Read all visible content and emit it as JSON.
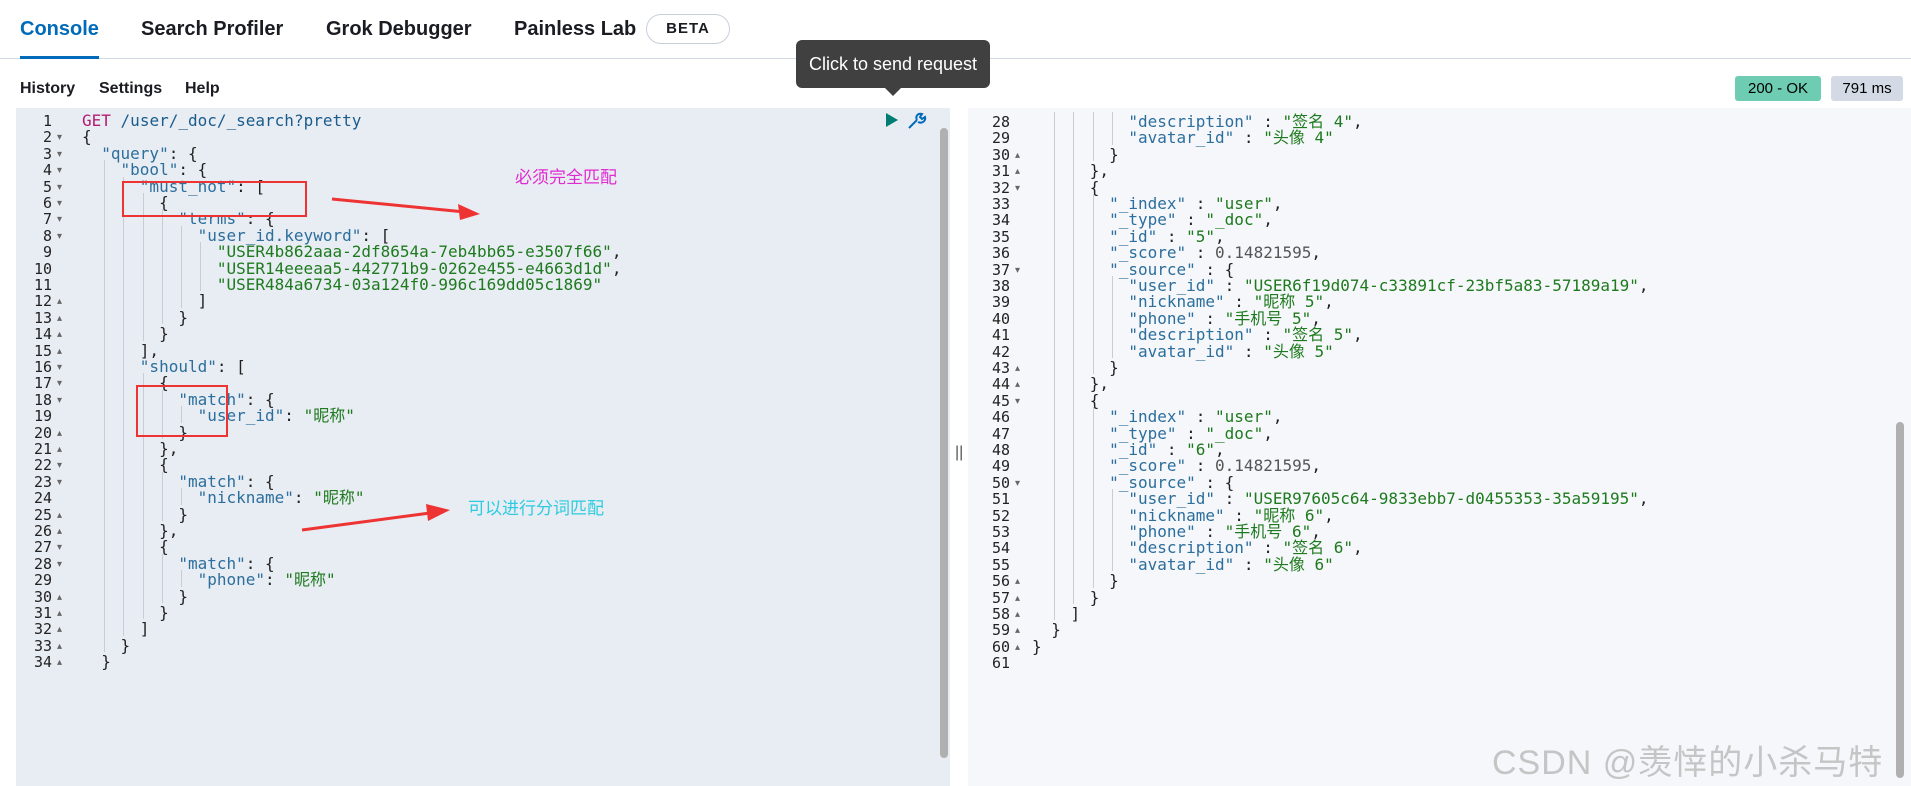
{
  "tabs": [
    {
      "label": "Console",
      "active": true
    },
    {
      "label": "Search Profiler",
      "active": false
    },
    {
      "label": "Grok Debugger",
      "active": false
    },
    {
      "label": "Painless Lab",
      "active": false
    }
  ],
  "beta_badge": "BETA",
  "menu": {
    "history": "History",
    "settings": "Settings",
    "help": "Help"
  },
  "tooltip": "Click to send request",
  "status": {
    "code": "200 - OK",
    "time": "791 ms"
  },
  "annotations": {
    "must_not_note": "必须完全匹配",
    "should_note": "可以进行分词匹配"
  },
  "watermark": "CSDN @羡悻的小杀马特",
  "splitter": "||",
  "colors": {
    "accent": "#006bb8",
    "ok": "#6dccb1",
    "annotation_red": "#ee3333",
    "note_magenta": "#e02bd0",
    "note_cyan": "#2ccbe0"
  },
  "request_lines": [
    {
      "n": 1,
      "t": "GET /user/_doc/_search?pretty",
      "fold": false,
      "type": "req"
    },
    {
      "n": 2,
      "t": "{",
      "fold": true
    },
    {
      "n": 3,
      "t": "  \"query\": {",
      "fold": true
    },
    {
      "n": 4,
      "t": "    \"bool\": {",
      "fold": true
    },
    {
      "n": 5,
      "t": "      \"must_not\": [",
      "fold": true
    },
    {
      "n": 6,
      "t": "        {",
      "fold": true
    },
    {
      "n": 7,
      "t": "          \"terms\": {",
      "fold": true
    },
    {
      "n": 8,
      "t": "            \"user_id.keyword\": [",
      "fold": true
    },
    {
      "n": 9,
      "t": "              \"USER4b862aaa-2df8654a-7eb4bb65-e3507f66\",",
      "fold": false
    },
    {
      "n": 10,
      "t": "              \"USER14eeeaa5-442771b9-0262e455-e4663d1d\",",
      "fold": false
    },
    {
      "n": 11,
      "t": "              \"USER484a6734-03a124f0-996c169dd05c1869\"",
      "fold": false
    },
    {
      "n": 12,
      "t": "            ]",
      "fold": true
    },
    {
      "n": 13,
      "t": "          }",
      "fold": true
    },
    {
      "n": 14,
      "t": "        }",
      "fold": true
    },
    {
      "n": 15,
      "t": "      ],",
      "fold": true
    },
    {
      "n": 16,
      "t": "      \"should\": [",
      "fold": true
    },
    {
      "n": 17,
      "t": "        {",
      "fold": true
    },
    {
      "n": 18,
      "t": "          \"match\": {",
      "fold": true
    },
    {
      "n": 19,
      "t": "            \"user_id\": \"昵称\"",
      "fold": false
    },
    {
      "n": 20,
      "t": "          }",
      "fold": true
    },
    {
      "n": 21,
      "t": "        },",
      "fold": true
    },
    {
      "n": 22,
      "t": "        {",
      "fold": true
    },
    {
      "n": 23,
      "t": "          \"match\": {",
      "fold": true
    },
    {
      "n": 24,
      "t": "            \"nickname\": \"昵称\"",
      "fold": false
    },
    {
      "n": 25,
      "t": "          }",
      "fold": true
    },
    {
      "n": 26,
      "t": "        },",
      "fold": true
    },
    {
      "n": 27,
      "t": "        {",
      "fold": true
    },
    {
      "n": 28,
      "t": "          \"match\": {",
      "fold": true
    },
    {
      "n": 29,
      "t": "            \"phone\": \"昵称\"",
      "fold": false
    },
    {
      "n": 30,
      "t": "          }",
      "fold": true
    },
    {
      "n": 31,
      "t": "        }",
      "fold": true
    },
    {
      "n": 32,
      "t": "      ]",
      "fold": true
    },
    {
      "n": 33,
      "t": "    }",
      "fold": true
    },
    {
      "n": 34,
      "t": "  }",
      "fold": true
    }
  ],
  "response_lines": [
    {
      "n": 28,
      "t": "          \"description\" : \"签名 4\",",
      "fold": false
    },
    {
      "n": 29,
      "t": "          \"avatar_id\" : \"头像 4\"",
      "fold": false
    },
    {
      "n": 30,
      "t": "        }",
      "fold": true
    },
    {
      "n": 31,
      "t": "      },",
      "fold": true
    },
    {
      "n": 32,
      "t": "      {",
      "fold": true
    },
    {
      "n": 33,
      "t": "        \"_index\" : \"user\",",
      "fold": false
    },
    {
      "n": 34,
      "t": "        \"_type\" : \"_doc\",",
      "fold": false
    },
    {
      "n": 35,
      "t": "        \"_id\" : \"5\",",
      "fold": false
    },
    {
      "n": 36,
      "t": "        \"_score\" : 0.14821595,",
      "fold": false
    },
    {
      "n": 37,
      "t": "        \"_source\" : {",
      "fold": true
    },
    {
      "n": 38,
      "t": "          \"user_id\" : \"USER6f19d074-c33891cf-23bf5a83-57189a19\",",
      "fold": false
    },
    {
      "n": 39,
      "t": "          \"nickname\" : \"昵称 5\",",
      "fold": false
    },
    {
      "n": 40,
      "t": "          \"phone\" : \"手机号 5\",",
      "fold": false
    },
    {
      "n": 41,
      "t": "          \"description\" : \"签名 5\",",
      "fold": false
    },
    {
      "n": 42,
      "t": "          \"avatar_id\" : \"头像 5\"",
      "fold": false
    },
    {
      "n": 43,
      "t": "        }",
      "fold": true
    },
    {
      "n": 44,
      "t": "      },",
      "fold": true
    },
    {
      "n": 45,
      "t": "      {",
      "fold": true
    },
    {
      "n": 46,
      "t": "        \"_index\" : \"user\",",
      "fold": false
    },
    {
      "n": 47,
      "t": "        \"_type\" : \"_doc\",",
      "fold": false
    },
    {
      "n": 48,
      "t": "        \"_id\" : \"6\",",
      "fold": false
    },
    {
      "n": 49,
      "t": "        \"_score\" : 0.14821595,",
      "fold": false
    },
    {
      "n": 50,
      "t": "        \"_source\" : {",
      "fold": true
    },
    {
      "n": 51,
      "t": "          \"user_id\" : \"USER97605c64-9833ebb7-d0455353-35a59195\",",
      "fold": false
    },
    {
      "n": 52,
      "t": "          \"nickname\" : \"昵称 6\",",
      "fold": false
    },
    {
      "n": 53,
      "t": "          \"phone\" : \"手机号 6\",",
      "fold": false
    },
    {
      "n": 54,
      "t": "          \"description\" : \"签名 6\",",
      "fold": false
    },
    {
      "n": 55,
      "t": "          \"avatar_id\" : \"头像 6\"",
      "fold": false
    },
    {
      "n": 56,
      "t": "        }",
      "fold": true
    },
    {
      "n": 57,
      "t": "      }",
      "fold": true
    },
    {
      "n": 58,
      "t": "    ]",
      "fold": true
    },
    {
      "n": 59,
      "t": "  }",
      "fold": true
    },
    {
      "n": 60,
      "t": "}",
      "fold": true
    },
    {
      "n": 61,
      "t": "",
      "fold": false
    }
  ]
}
